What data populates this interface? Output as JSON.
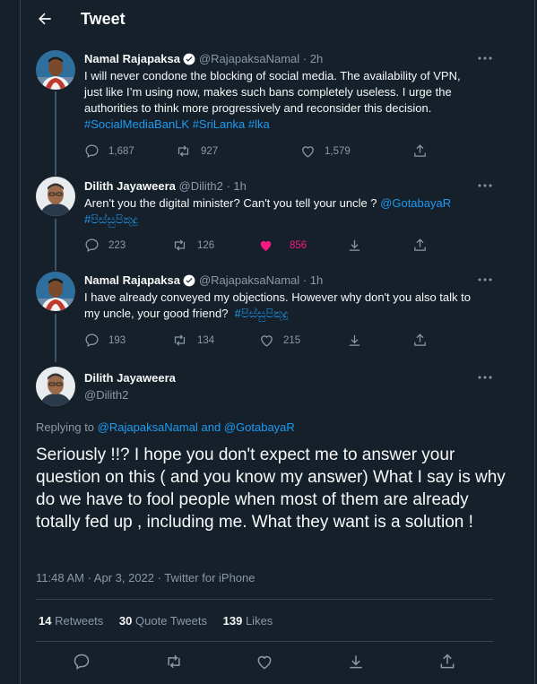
{
  "header": {
    "title": "Tweet",
    "back_icon": "arrow-left-icon"
  },
  "tweets": [
    {
      "name": "Namal Rajapaksa",
      "verified": true,
      "handle": "@RajapaksaNamal",
      "time": "· 2h",
      "text_lines": [
        "I will never condone the blocking of social media. The availability of VPN,",
        "just like I’m using now, makes such bans completely useless. I urge the",
        "authorities to think more progressively and reconsider this decision."
      ],
      "hashtags": "#SocialMediaBanLK #SriLanka #lka",
      "replies": "1,687",
      "retweets": "927",
      "likes": "1,579"
    },
    {
      "name": "Dilith Jayaweera",
      "handle": "@Dilith2",
      "time": "· 1h",
      "text_line1": "Aren't you the digital minister? Can't you tell your uncle ?",
      "mention": "@GotabayaR",
      "hashtag": "#පිස්සුපිකූදු",
      "replies": "223",
      "retweets": "126",
      "likes": "856",
      "liked_color": "#f91880"
    },
    {
      "name": "Namal Rajapaksa",
      "verified": true,
      "handle": "@RajapaksaNamal",
      "time": "· 1h",
      "text_line1": "I have already conveyed my objections. However why don't you also talk to",
      "text_line2": "my uncle, your good friend?",
      "hashtag": "#පිස්සුපිකූදු",
      "replies": "193",
      "retweets": "134",
      "likes": "215"
    }
  ],
  "main": {
    "name": "Dilith Jayaweera",
    "handle": "@Dilith2",
    "replying_prefix": "Replying to",
    "replying_to_1": "@RajapaksaNamal",
    "replying_and": "and",
    "replying_to_2": "@GotabayaR",
    "text": "Seriously !!? I hope you don't expect me to answer your question on this ( and you know my answer) What I say is why do we have to fool people when most of them are already totally fed up , including me. What they want is a solution !",
    "timestamp": "11:48 AM · Apr 3, 2022 · Twitter for iPhone",
    "retweets_count": "14",
    "retweets_label": "Retweets",
    "quotes_count": "30",
    "quotes_label": "Quote Tweets",
    "likes_count": "139",
    "likes_label": "Likes"
  },
  "colors": {
    "background": "#15202b",
    "accent": "#1d9bf0",
    "muted": "#8b98a5",
    "like": "#f91880",
    "border": "#38444d"
  }
}
